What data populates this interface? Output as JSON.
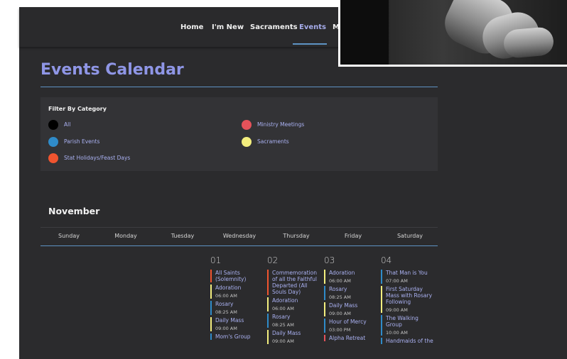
{
  "nav": {
    "items": [
      {
        "label": "Home"
      },
      {
        "label": "I'm New"
      },
      {
        "label": "Sacraments"
      },
      {
        "label": "Events"
      },
      {
        "label": "M"
      }
    ]
  },
  "page": {
    "title": "Events Calendar"
  },
  "filters": {
    "title": "Filter By Category",
    "options": [
      {
        "label": "All",
        "color": "#000000"
      },
      {
        "label": "Ministry Meetings",
        "color": "#e5525a"
      },
      {
        "label": "Parish Events",
        "color": "#2f8bc9"
      },
      {
        "label": "Sacraments",
        "color": "#f3ee7e"
      },
      {
        "label": "Stat Holidays/Feast Days",
        "color": "#f0542f"
      }
    ]
  },
  "calendar": {
    "month": "November",
    "weekdays": [
      "Sunday",
      "Monday",
      "Tuesday",
      "Wednesday",
      "Thursday",
      "Friday",
      "Saturday"
    ],
    "days": [
      {
        "num": "01",
        "events": [
          {
            "title": "All Saints (Solemnity)",
            "time": "",
            "color": "#f0542f"
          },
          {
            "title": "Adoration",
            "time": "06:00 AM",
            "color": "#f3ee7e"
          },
          {
            "title": "Rosary",
            "time": "08:25 AM",
            "color": "#2f8bc9"
          },
          {
            "title": "Daily Mass",
            "time": "09:00 AM",
            "color": "#f3ee7e"
          },
          {
            "title": "Mom's Group",
            "time": "",
            "color": "#2f8bc9"
          }
        ]
      },
      {
        "num": "02",
        "events": [
          {
            "title": "Commemoration of all the Faithful Departed (All Souls Day)",
            "time": "",
            "color": "#f0542f"
          },
          {
            "title": "Adoration",
            "time": "06:00 AM",
            "color": "#f3ee7e"
          },
          {
            "title": "Rosary",
            "time": "08:25 AM",
            "color": "#2f8bc9"
          },
          {
            "title": "Daily Mass",
            "time": "09:00 AM",
            "color": "#f3ee7e"
          }
        ]
      },
      {
        "num": "03",
        "events": [
          {
            "title": "Adoration",
            "time": "06:00 AM",
            "color": "#f3ee7e"
          },
          {
            "title": "Rosary",
            "time": "08:25 AM",
            "color": "#2f8bc9"
          },
          {
            "title": "Daily Mass",
            "time": "09:00 AM",
            "color": "#f3ee7e"
          },
          {
            "title": "Hour of Mercy",
            "time": "03:00 PM",
            "color": "#2f8bc9"
          },
          {
            "title": "Alpha Retreat",
            "time": "",
            "color": "#e5525a"
          }
        ]
      },
      {
        "num": "04",
        "events": [
          {
            "title": "That Man is You",
            "time": "07:00 AM",
            "color": "#2f8bc9"
          },
          {
            "title": "First Saturday Mass with Rosary Following",
            "time": "09:00 AM",
            "color": "#f3ee7e"
          },
          {
            "title": "The Walking Group",
            "time": "10:00 AM",
            "color": "#2f8bc9"
          },
          {
            "title": "Handmaids of the",
            "time": "",
            "color": "#2f8bc9"
          }
        ]
      }
    ]
  }
}
